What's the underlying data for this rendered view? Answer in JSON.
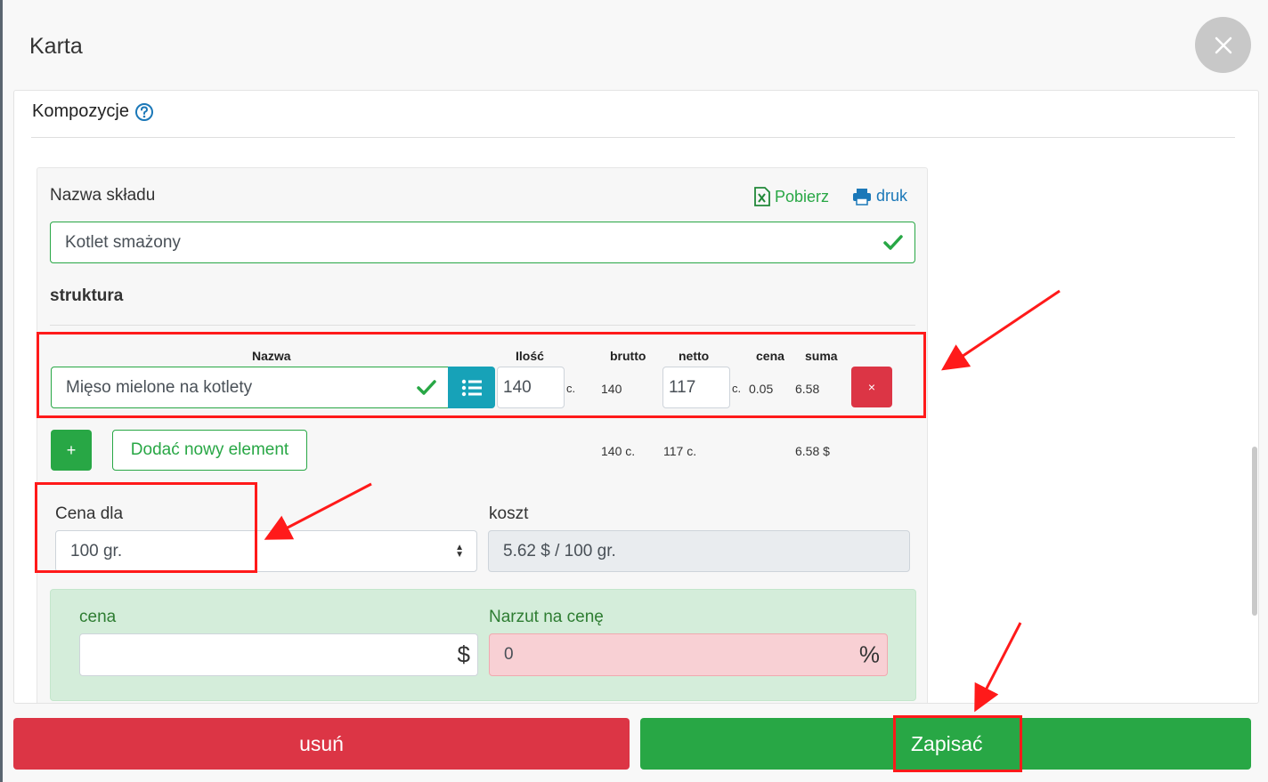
{
  "modal": {
    "title": "Karta",
    "section_title": "Kompozycje"
  },
  "composition": {
    "name_label": "Nazwa składu",
    "download_label": "Pobierz",
    "print_label": "druk",
    "name_value": "Kotlet smażony",
    "structure_label": "struktura"
  },
  "table": {
    "headers": {
      "name": "Nazwa",
      "qty": "Ilość",
      "gross": "brutto",
      "net": "netto",
      "price": "cena",
      "sum": "suma"
    },
    "rows": [
      {
        "name": "Mięso mielone na kotlety",
        "qty": "140",
        "qty_unit": "c.",
        "gross": "140",
        "net": "117",
        "net_unit": "c.",
        "price": "0.05",
        "sum": "6.58",
        "delete": "×"
      }
    ],
    "totals": {
      "gross": "140 c.",
      "net": "117 c.",
      "sum": "6.58 $"
    }
  },
  "actions": {
    "add": "+",
    "add_new": "Dodać nowy element"
  },
  "pricing": {
    "price_for_label": "Cena dla",
    "price_for_value": "100 gr.",
    "cost_label": "koszt",
    "cost_value": "5.62 $ / 100 gr.",
    "price_label": "cena",
    "price_value": "",
    "currency_suffix": "$",
    "markup_label": "Narzut na cenę",
    "markup_value": "0",
    "percent_suffix": "%"
  },
  "footer": {
    "delete_label": "usuń",
    "save_label": "Zapisać"
  },
  "colors": {
    "success": "#28a745",
    "danger": "#dc3545",
    "info": "#17a2b8",
    "annotation": "#ff1a1a"
  }
}
